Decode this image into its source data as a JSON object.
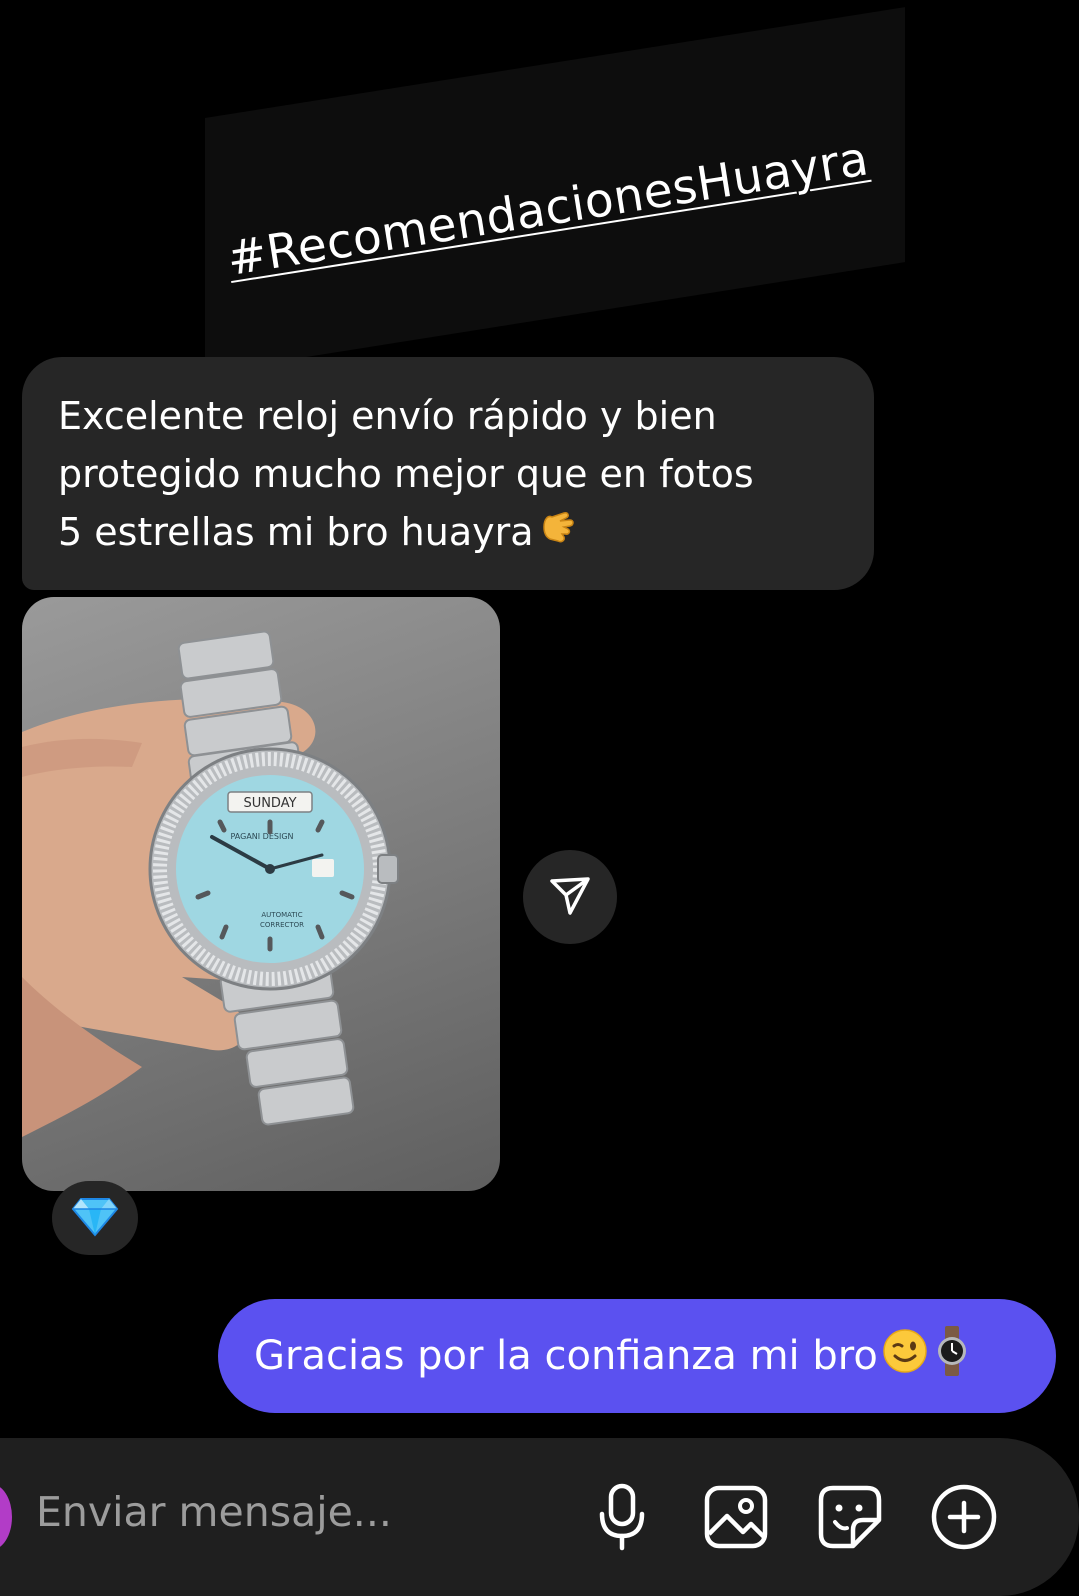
{
  "story_overlay": {
    "hashtag": "#RecomendacionesHuayra"
  },
  "received_message": {
    "lines": [
      "Excelente reloj envío rápido y bien",
      "protegido mucho mejor que en fotos",
      "5 estrellas mi bro huayra"
    ],
    "trailing_emoji_icon": "call-me-hand-icon"
  },
  "photo_message": {
    "dial": {
      "day_window": "SUNDAY",
      "brand": "PAGANI DESIGN",
      "subtitle_1": "AUTOMATIC",
      "subtitle_2": "CORRECTOR"
    },
    "share_icon": "send-arrow-icon",
    "reaction_icon": "gem-icon"
  },
  "sent_message": {
    "text": "Gracias por la confianza mi bro",
    "emoji_icons": [
      "winking-face-icon",
      "watch-icon"
    ],
    "accent_color": "#5b51f0"
  },
  "composer": {
    "placeholder": "Enviar mensaje...",
    "icons": [
      "microphone-icon",
      "gallery-icon",
      "sticker-icon",
      "plus-icon"
    ]
  }
}
